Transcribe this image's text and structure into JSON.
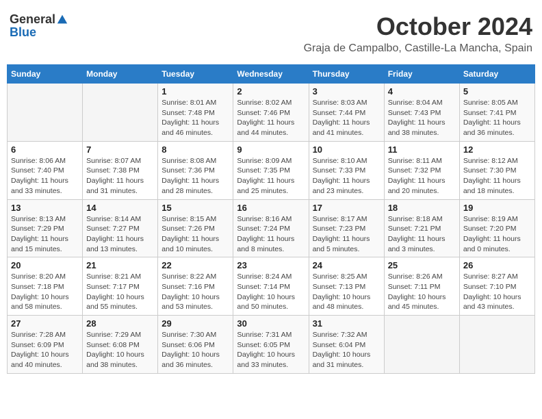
{
  "header": {
    "logo_general": "General",
    "logo_blue": "Blue",
    "month": "October 2024",
    "location": "Graja de Campalbo, Castille-La Mancha, Spain"
  },
  "days_of_week": [
    "Sunday",
    "Monday",
    "Tuesday",
    "Wednesday",
    "Thursday",
    "Friday",
    "Saturday"
  ],
  "weeks": [
    [
      {
        "day": "",
        "info": ""
      },
      {
        "day": "",
        "info": ""
      },
      {
        "day": "1",
        "info": "Sunrise: 8:01 AM\nSunset: 7:48 PM\nDaylight: 11 hours and 46 minutes."
      },
      {
        "day": "2",
        "info": "Sunrise: 8:02 AM\nSunset: 7:46 PM\nDaylight: 11 hours and 44 minutes."
      },
      {
        "day": "3",
        "info": "Sunrise: 8:03 AM\nSunset: 7:44 PM\nDaylight: 11 hours and 41 minutes."
      },
      {
        "day": "4",
        "info": "Sunrise: 8:04 AM\nSunset: 7:43 PM\nDaylight: 11 hours and 38 minutes."
      },
      {
        "day": "5",
        "info": "Sunrise: 8:05 AM\nSunset: 7:41 PM\nDaylight: 11 hours and 36 minutes."
      }
    ],
    [
      {
        "day": "6",
        "info": "Sunrise: 8:06 AM\nSunset: 7:40 PM\nDaylight: 11 hours and 33 minutes."
      },
      {
        "day": "7",
        "info": "Sunrise: 8:07 AM\nSunset: 7:38 PM\nDaylight: 11 hours and 31 minutes."
      },
      {
        "day": "8",
        "info": "Sunrise: 8:08 AM\nSunset: 7:36 PM\nDaylight: 11 hours and 28 minutes."
      },
      {
        "day": "9",
        "info": "Sunrise: 8:09 AM\nSunset: 7:35 PM\nDaylight: 11 hours and 25 minutes."
      },
      {
        "day": "10",
        "info": "Sunrise: 8:10 AM\nSunset: 7:33 PM\nDaylight: 11 hours and 23 minutes."
      },
      {
        "day": "11",
        "info": "Sunrise: 8:11 AM\nSunset: 7:32 PM\nDaylight: 11 hours and 20 minutes."
      },
      {
        "day": "12",
        "info": "Sunrise: 8:12 AM\nSunset: 7:30 PM\nDaylight: 11 hours and 18 minutes."
      }
    ],
    [
      {
        "day": "13",
        "info": "Sunrise: 8:13 AM\nSunset: 7:29 PM\nDaylight: 11 hours and 15 minutes."
      },
      {
        "day": "14",
        "info": "Sunrise: 8:14 AM\nSunset: 7:27 PM\nDaylight: 11 hours and 13 minutes."
      },
      {
        "day": "15",
        "info": "Sunrise: 8:15 AM\nSunset: 7:26 PM\nDaylight: 11 hours and 10 minutes."
      },
      {
        "day": "16",
        "info": "Sunrise: 8:16 AM\nSunset: 7:24 PM\nDaylight: 11 hours and 8 minutes."
      },
      {
        "day": "17",
        "info": "Sunrise: 8:17 AM\nSunset: 7:23 PM\nDaylight: 11 hours and 5 minutes."
      },
      {
        "day": "18",
        "info": "Sunrise: 8:18 AM\nSunset: 7:21 PM\nDaylight: 11 hours and 3 minutes."
      },
      {
        "day": "19",
        "info": "Sunrise: 8:19 AM\nSunset: 7:20 PM\nDaylight: 11 hours and 0 minutes."
      }
    ],
    [
      {
        "day": "20",
        "info": "Sunrise: 8:20 AM\nSunset: 7:18 PM\nDaylight: 10 hours and 58 minutes."
      },
      {
        "day": "21",
        "info": "Sunrise: 8:21 AM\nSunset: 7:17 PM\nDaylight: 10 hours and 55 minutes."
      },
      {
        "day": "22",
        "info": "Sunrise: 8:22 AM\nSunset: 7:16 PM\nDaylight: 10 hours and 53 minutes."
      },
      {
        "day": "23",
        "info": "Sunrise: 8:24 AM\nSunset: 7:14 PM\nDaylight: 10 hours and 50 minutes."
      },
      {
        "day": "24",
        "info": "Sunrise: 8:25 AM\nSunset: 7:13 PM\nDaylight: 10 hours and 48 minutes."
      },
      {
        "day": "25",
        "info": "Sunrise: 8:26 AM\nSunset: 7:11 PM\nDaylight: 10 hours and 45 minutes."
      },
      {
        "day": "26",
        "info": "Sunrise: 8:27 AM\nSunset: 7:10 PM\nDaylight: 10 hours and 43 minutes."
      }
    ],
    [
      {
        "day": "27",
        "info": "Sunrise: 7:28 AM\nSunset: 6:09 PM\nDaylight: 10 hours and 40 minutes."
      },
      {
        "day": "28",
        "info": "Sunrise: 7:29 AM\nSunset: 6:08 PM\nDaylight: 10 hours and 38 minutes."
      },
      {
        "day": "29",
        "info": "Sunrise: 7:30 AM\nSunset: 6:06 PM\nDaylight: 10 hours and 36 minutes."
      },
      {
        "day": "30",
        "info": "Sunrise: 7:31 AM\nSunset: 6:05 PM\nDaylight: 10 hours and 33 minutes."
      },
      {
        "day": "31",
        "info": "Sunrise: 7:32 AM\nSunset: 6:04 PM\nDaylight: 10 hours and 31 minutes."
      },
      {
        "day": "",
        "info": ""
      },
      {
        "day": "",
        "info": ""
      }
    ]
  ]
}
